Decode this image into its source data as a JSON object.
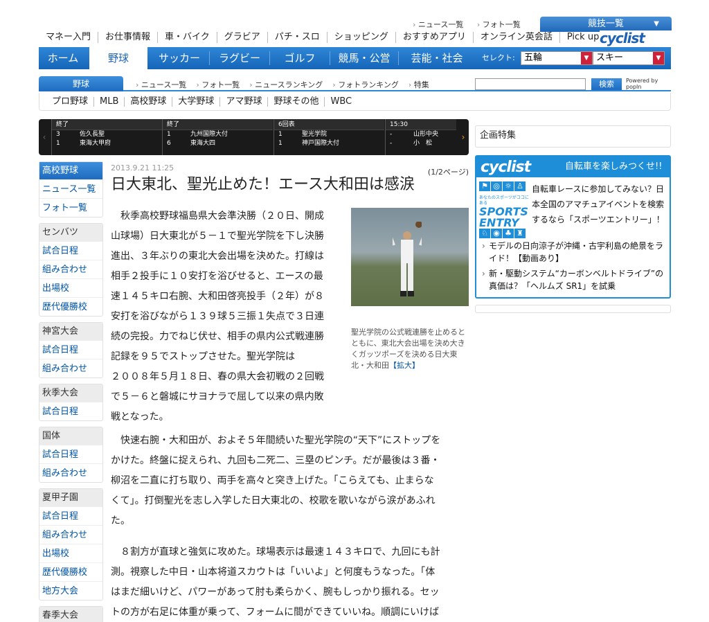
{
  "header": {
    "top_links": [
      "ニュース一覧",
      "フォト一覧"
    ],
    "kyogi_label": "競技一覧",
    "sub_nav": [
      "マネー入門",
      "お仕事情報",
      "車・バイク",
      "グラビア",
      "パチ・スロ",
      "ショッピング",
      "おすすめアプリ",
      "オンライン英会話",
      "Pick up"
    ],
    "cyclist_logo": "cyclist"
  },
  "main_nav": {
    "tabs": [
      "ホーム",
      "野球",
      "サッカー",
      "ラグビー",
      "ゴルフ",
      "競馬・公営",
      "芸能・社会"
    ],
    "select_label": "セレクト:",
    "select1": "五輪",
    "select2": "スキー"
  },
  "section": {
    "tab": "野球",
    "links": [
      "ニュース一覧",
      "フォト一覧",
      "ニュースランキング",
      "フォトランキング",
      "特集"
    ],
    "search_button": "検索",
    "powered": "Powered by popIn"
  },
  "categories": [
    "プロ野球",
    "MLB",
    "高校野球",
    "大学野球",
    "アマ野球",
    "野球その他",
    "WBC"
  ],
  "scoreboard": [
    {
      "status": "終了",
      "rows": [
        {
          "score": "3",
          "team": "佐久長聖"
        },
        {
          "score": "1",
          "team": "東海大甲府"
        }
      ]
    },
    {
      "status": "終了",
      "rows": [
        {
          "score": "1",
          "team": "九州国際大付"
        },
        {
          "score": "6",
          "team": "東海大四"
        }
      ]
    },
    {
      "status": "6回表",
      "rows": [
        {
          "score": "1",
          "team": "聖光学院"
        },
        {
          "score": "1",
          "team": "神戸国際大付"
        }
      ]
    },
    {
      "status": "15:30",
      "rows": [
        {
          "score": "-",
          "team": "山形中央"
        },
        {
          "score": "-",
          "team": "小　松"
        }
      ]
    }
  ],
  "sidebar": [
    {
      "head": "高校野球",
      "items": [
        "ニュース一覧",
        "フォト一覧"
      ]
    },
    {
      "head": "センバツ",
      "items": [
        "試合日程",
        "組み合わせ",
        "出場校",
        "歴代優勝校"
      ]
    },
    {
      "head": "神宮大会",
      "items": [
        "試合日程",
        "組み合わせ"
      ]
    },
    {
      "head": "秋季大会",
      "items": [
        "試合日程"
      ]
    },
    {
      "head": "国体",
      "items": [
        "試合日程",
        "組み合わせ"
      ]
    },
    {
      "head": "夏甲子園",
      "items": [
        "試合日程",
        "組み合わせ",
        "出場校",
        "歴代優勝校",
        "地方大会"
      ]
    },
    {
      "head": "春季大会",
      "items": []
    }
  ],
  "article": {
    "date": "2013.9.21 11:25",
    "pages": "(1/2ページ)",
    "title": "日大東北、聖光止めた！エース大和田は感涙",
    "caption": "聖光学院の公式戦連勝を止めるとともに、東北大会出場を決め大きくガッツポーズを決める日大東北・大和田",
    "enlarge": "【拡大】",
    "para1": [
      "　秋季高校野球福島県大会準決勝（２０日、開成",
      "山球場）日大東北が５－１で聖光学院を下し決勝",
      "進出、３年ぶりの東北大会出場を決めた。打線は",
      "相手２投手に１０安打を浴びせると、エースの最",
      "速１４５キロ右腕、大和田啓亮投手（２年）が８",
      "安打を浴びながら１３９球５三振１失点で３日連",
      "続の完投。力でねじ伏せ、相手の県内公式戦連勝",
      "記録を９５でストップさせた。聖光学院は",
      "２００８年５月１８日、春の県大会初戦の２回戦",
      "で５－６と磐城にサヨナラで屈して以来の県内敗",
      "戦となった。"
    ],
    "para2": [
      "　快速右腕・大和田が、およそ５年間続いた聖光学院の“天下”にストップを",
      "かけた。終盤に捉えられ、九回も二死二、三塁のピンチ。だが最後は３番・",
      "柳沼を二直に打ち取り、両手を高々と突き上げた。「こらえても、止まらな",
      "くて」。打倒聖光を志し入学した日大東北の、校歌を歌いながら涙があふれ",
      "た。"
    ],
    "para3": [
      "　８割方が直球と強気に攻めた。球場表示は最速１４３キロで、九回にも計",
      "測。視察した中日・山本将道スカウトは「いいよ」と何度もうなった。「体",
      "はまだ細いけど、パワーがあって肘も柔らかく、腕もしっかり振れる。セッ",
      "トの方が右足に体重が乗って、フォームに間ができていいね。順調にいけば"
    ]
  },
  "right": {
    "kikaku": "企画特集",
    "cyc_logo": "cyclist",
    "cyc_head": "自転車を楽しみつくせ!!",
    "entry_small": "あなたのスポーツがココにある",
    "entry_big1": "SPORTS",
    "entry_big2": "ENTRY",
    "cyc_text": "自転車レースに参加してみない？日本全国のアマチュアイベントを検索するなら「スポーツエントリー」！",
    "link1": "モデルの日向涼子が沖縄・古宇利島の絶景をライド！【動画あり】",
    "link2": "新・駆動システム“カーボンベルトドライブ”の真価は？「ヘルムズ SR1」を試乗"
  }
}
